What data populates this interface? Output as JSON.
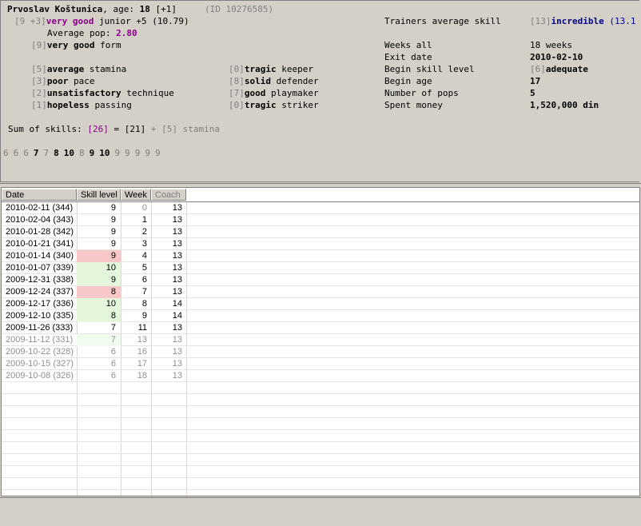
{
  "player": {
    "name": "Prvoslav Koštunica",
    "age_prefix": ", age: ",
    "age": "18",
    "age_delta": "[+1]",
    "id_text": "(ID 10276585)"
  },
  "overall": {
    "bracket": "[9 +3]",
    "level": "very good",
    "rest": "junior +5 (10.79)",
    "pop_label": "Average pop: ",
    "pop_value": "2.80"
  },
  "form": {
    "bracket": "[9]",
    "level": "very good",
    "label": "form"
  },
  "skills_left": [
    {
      "bracket": "[5]",
      "level": "average",
      "label": "stamina"
    },
    {
      "bracket": "[3]",
      "level": "poor",
      "label": "pace"
    },
    {
      "bracket": "[2]",
      "level": "unsatisfactory",
      "label": "technique"
    },
    {
      "bracket": "[1]",
      "level": "hopeless",
      "label": "passing"
    }
  ],
  "skills_mid": [
    {
      "bracket": "[0]",
      "level": "tragic",
      "label": "keeper"
    },
    {
      "bracket": "[8]",
      "level": "solid",
      "label": "defender"
    },
    {
      "bracket": "[7]",
      "level": "good",
      "label": "playmaker"
    },
    {
      "bracket": "[0]",
      "level": "tragic",
      "label": "striker"
    }
  ],
  "trainers": {
    "label": "Trainers average skill",
    "bracket": "[13]",
    "level": "incredible",
    "value": "(13.1"
  },
  "stats": [
    {
      "label": "Weeks all",
      "value": "18 weeks"
    },
    {
      "label": "Exit date",
      "value": "2010-02-10"
    },
    {
      "label": "Begin skill level",
      "bracket": "[6]",
      "value": "adequate"
    },
    {
      "label": "Begin age",
      "value": "17"
    },
    {
      "label": "Number of pops",
      "value": "5"
    },
    {
      "label": "Spent money",
      "value": "1,520,000 din"
    }
  ],
  "sum": {
    "label": "Sum of skills: ",
    "total": "[26]",
    "eq": " = ",
    "part1": "[21]",
    "plus": " + ",
    "part2": "[5]",
    "part2_label": " stamina"
  },
  "sequence": [
    "6",
    "6",
    "6",
    "7",
    "7",
    "8",
    "10",
    "8",
    "9",
    "10",
    "9",
    "9",
    "9",
    "9",
    "9"
  ],
  "sequence_bold": [
    false,
    false,
    false,
    true,
    false,
    true,
    true,
    false,
    true,
    true,
    false,
    false,
    false,
    false,
    false
  ],
  "table": {
    "headers": [
      "Date",
      "Skill level",
      "Week",
      "Coach"
    ],
    "rows": [
      {
        "date": "2010-02-11 (344)",
        "skill": "9",
        "week": "0",
        "coach": "13",
        "bg": "",
        "dim_week": true,
        "dim": false
      },
      {
        "date": "2010-02-04 (343)",
        "skill": "9",
        "week": "1",
        "coach": "13",
        "bg": "",
        "dim_week": false,
        "dim": false
      },
      {
        "date": "2010-01-28 (342)",
        "skill": "9",
        "week": "2",
        "coach": "13",
        "bg": "",
        "dim_week": false,
        "dim": false
      },
      {
        "date": "2010-01-21 (341)",
        "skill": "9",
        "week": "3",
        "coach": "13",
        "bg": "",
        "dim_week": false,
        "dim": false
      },
      {
        "date": "2010-01-14 (340)",
        "skill": "9",
        "week": "4",
        "coach": "13",
        "bg": "red",
        "dim_week": false,
        "dim": false
      },
      {
        "date": "2010-01-07 (339)",
        "skill": "10",
        "week": "5",
        "coach": "13",
        "bg": "green",
        "dim_week": false,
        "dim": false
      },
      {
        "date": "2009-12-31 (338)",
        "skill": "9",
        "week": "6",
        "coach": "13",
        "bg": "green",
        "dim_week": false,
        "dim": false
      },
      {
        "date": "2009-12-24 (337)",
        "skill": "8",
        "week": "7",
        "coach": "13",
        "bg": "red",
        "dim_week": false,
        "dim": false
      },
      {
        "date": "2009-12-17 (336)",
        "skill": "10",
        "week": "8",
        "coach": "14",
        "bg": "green",
        "dim_week": false,
        "dim": false
      },
      {
        "date": "2009-12-10 (335)",
        "skill": "8",
        "week": "9",
        "coach": "14",
        "bg": "green",
        "dim_week": false,
        "dim": false
      },
      {
        "date": "2009-11-26 (333)",
        "skill": "7",
        "week": "11",
        "coach": "13",
        "bg": "",
        "dim_week": false,
        "dim": false
      },
      {
        "date": "2009-11-12 (331)",
        "skill": "7",
        "week": "13",
        "coach": "13",
        "bg": "lgreen",
        "dim_week": false,
        "dim": true
      },
      {
        "date": "2009-10-22 (328)",
        "skill": "6",
        "week": "16",
        "coach": "13",
        "bg": "",
        "dim_week": false,
        "dim": true
      },
      {
        "date": "2009-10-15 (327)",
        "skill": "6",
        "week": "17",
        "coach": "13",
        "bg": "",
        "dim_week": false,
        "dim": true
      },
      {
        "date": "2009-10-08 (326)",
        "skill": "6",
        "week": "18",
        "coach": "13",
        "bg": "",
        "dim_week": false,
        "dim": true
      }
    ]
  }
}
